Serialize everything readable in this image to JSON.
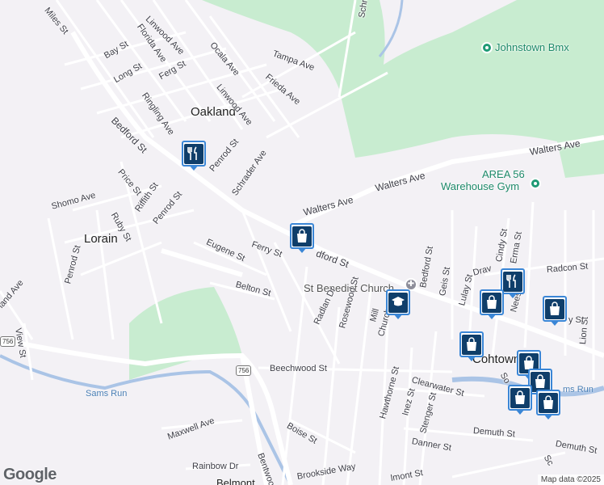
{
  "map": {
    "place_labels": [
      {
        "name": "oakland",
        "text": "Oakland"
      },
      {
        "name": "lorain",
        "text": "Lorain"
      },
      {
        "name": "conemaugh-town",
        "text": "Cohtown"
      },
      {
        "name": "belmont",
        "text": "Belmont"
      }
    ],
    "poi_labels": [
      {
        "name": "johnstown-bmx",
        "text": "Johnstown Bmx"
      },
      {
        "name": "area56-line1",
        "text": "AREA 56"
      },
      {
        "name": "area56-line2",
        "text": "Warehouse Gym"
      }
    ],
    "church_label": "St Benedict Church",
    "water_label": "Sams Run",
    "water_label_2": "ms Run",
    "route_shields": [
      "756",
      "756"
    ],
    "street_labels": [
      "Miles St",
      "Linwood Ave",
      "Florida Ave",
      "Ocala Ave",
      "Tampa Ave",
      "Frieda Ave",
      "Bay St",
      "Long St",
      "Ferg St",
      "Ringling Ave",
      "Linwood Ave",
      "Bedford St",
      "Penrod St",
      "Schrader Ave",
      "Price St",
      "Riffith St",
      "Shomo Ave",
      "Ruby St",
      "Penrod St",
      "Penrod St",
      "Eugene St",
      "Ferry St",
      "Belton St",
      "Walters Ave",
      "Walters Ave",
      "Walters Ave",
      "dford St",
      "Radlan Dr",
      "Rosewood St",
      "Mill",
      "Church",
      "Bedford St",
      "Geis St",
      "Lulay St",
      "Cindy St",
      "Erma St",
      "Drav",
      "Radcon St",
      "Nees Av",
      "Lion St",
      "Beechwood St",
      "Clearwater St",
      "Hawthorne St",
      "Inez St",
      "Stenger St",
      "Danner St",
      "Demuth St",
      "Demuth St",
      "Boise St",
      "Bentwood Av",
      "Maxwell Ave",
      "Rainbow Dr",
      "Brookside Way",
      "lmont St",
      "land Ave",
      "View St",
      "Schrader Ave",
      "y St",
      "So",
      "Sc"
    ],
    "markers": [
      {
        "name": "restaurant-marker",
        "icon": "fork-knife-icon"
      },
      {
        "name": "shopping-marker",
        "icon": "shopping-bag-icon"
      },
      {
        "name": "school-marker",
        "icon": "graduation-cap-icon"
      },
      {
        "name": "restaurant-marker",
        "icon": "fork-knife-icon"
      },
      {
        "name": "shopping-marker",
        "icon": "shopping-bag-icon"
      },
      {
        "name": "shopping-marker",
        "icon": "shopping-bag-icon"
      },
      {
        "name": "shopping-marker",
        "icon": "shopping-bag-icon"
      },
      {
        "name": "shopping-marker",
        "icon": "shopping-bag-icon"
      },
      {
        "name": "shopping-marker",
        "icon": "shopping-bag-icon"
      },
      {
        "name": "shopping-marker",
        "icon": "shopping-bag-icon"
      },
      {
        "name": "shopping-marker",
        "icon": "shopping-bag-icon"
      }
    ],
    "colors": {
      "park": "#c8ecd0",
      "water": "#aac4e6",
      "road": "#ffffff",
      "background": "#f3f1f5",
      "marker_border": "#3a86d6",
      "marker_fill": "#0f3e6a",
      "poi_green": "#1e9a75"
    },
    "logo": "Google",
    "attribution": "Map data ©2025"
  }
}
